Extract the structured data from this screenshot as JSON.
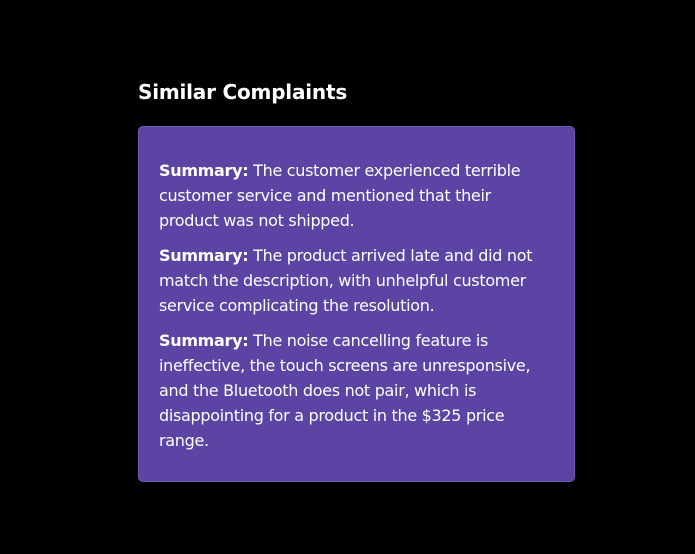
{
  "section": {
    "title": "Similar Complaints",
    "background_color": "#000000",
    "card_color": "#5b44a3"
  },
  "complaints": [
    {
      "label": "Summary:",
      "text": " The customer experienced terrible customer service and mentioned that their product was not shipped."
    },
    {
      "label": "Summary:",
      "text": " The product arrived late and did not match the description, with unhelpful customer service complicating the resolution."
    },
    {
      "label": "Summary:",
      "text": " The noise cancelling feature is ineffective, the touch screens are unresponsive, and the Bluetooth does not pair, which is disappointing for a product in the $325 price range."
    }
  ]
}
